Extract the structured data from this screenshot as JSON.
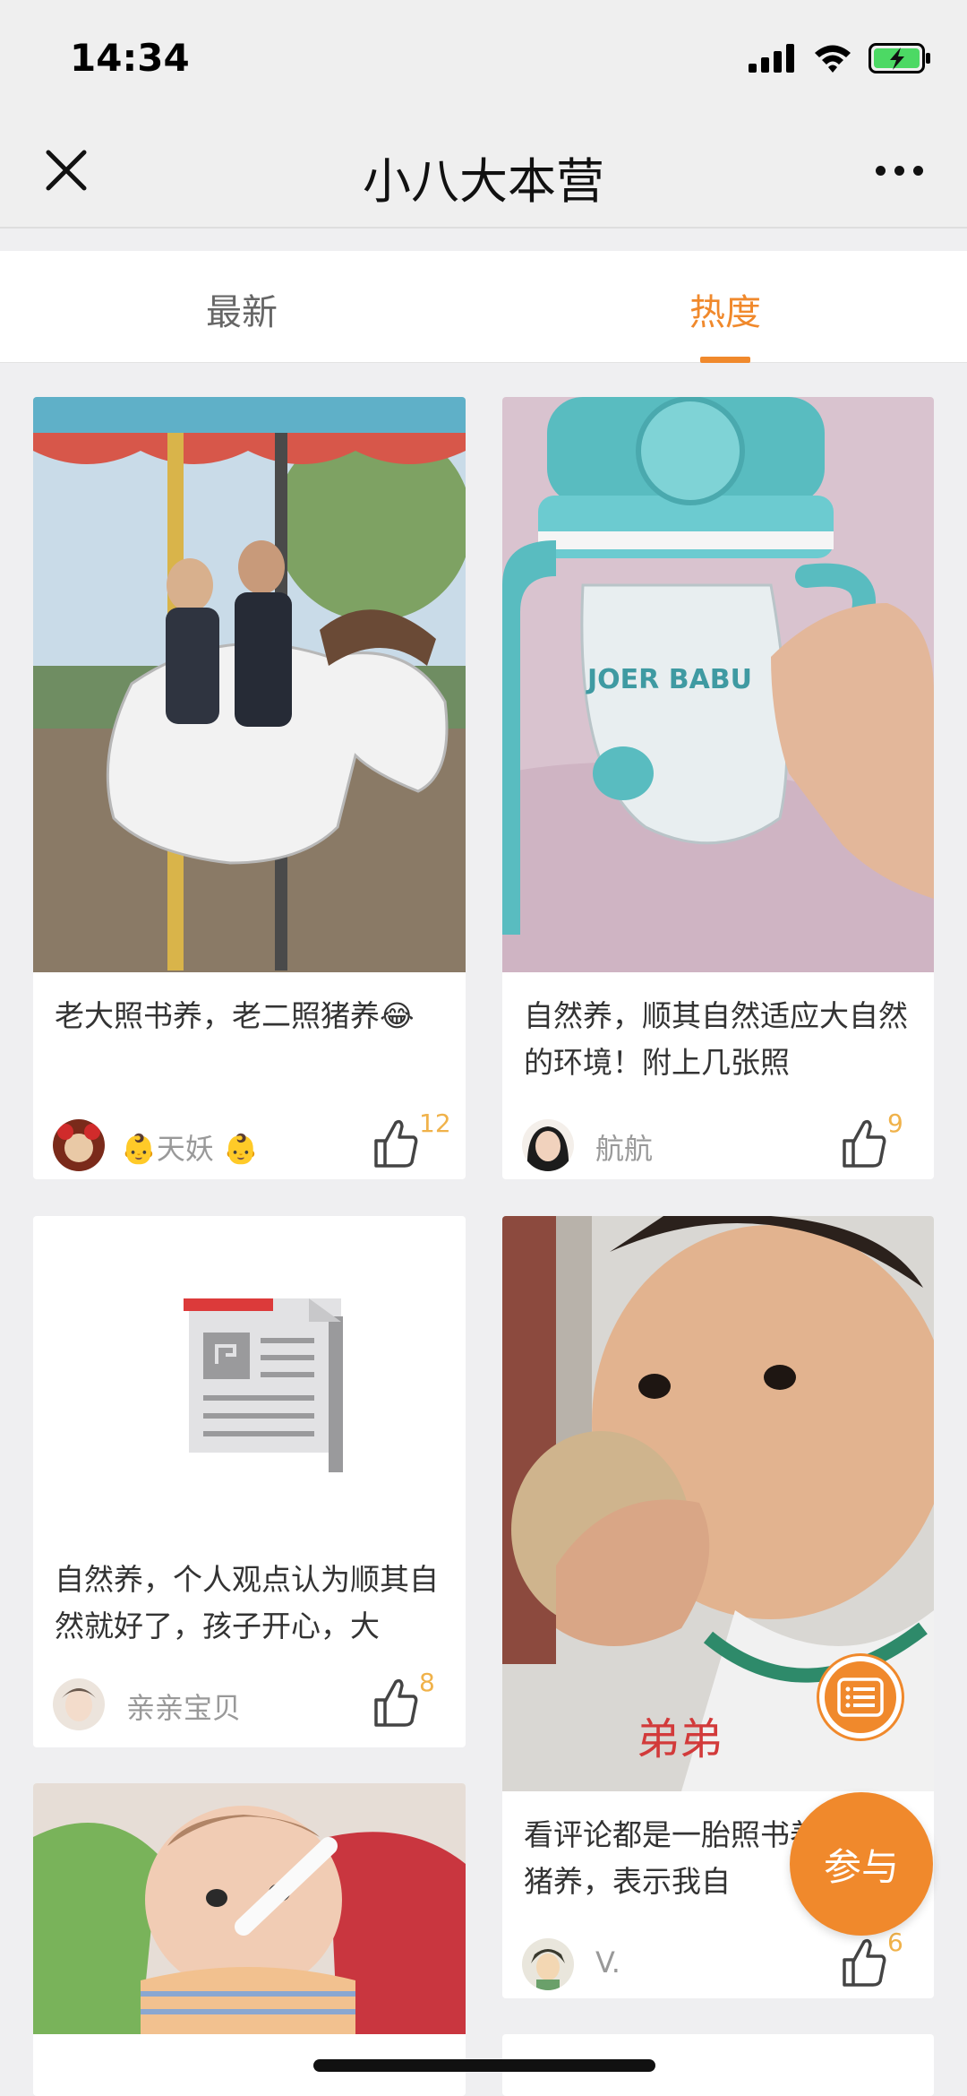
{
  "status_bar": {
    "time": "14:34"
  },
  "nav": {
    "title": "小八大本营"
  },
  "tabs": [
    {
      "label": "最新"
    },
    {
      "label": "热度"
    }
  ],
  "cards": [
    {
      "text": "老大照书养，老二照猪养😂",
      "author": "👶天妖 👶",
      "likes": "12"
    },
    {
      "text": "自然养，顺其自然适应大自然的环境！附上几张照",
      "author": "航航",
      "likes": "9"
    },
    {
      "text": "自然养，个人观点认为顺其自然就好了，孩子开心，大",
      "author": "亲亲宝贝",
      "likes": "8"
    },
    {
      "text": "看评论都是一胎照书养二胎照猪养，表示我自",
      "author": "V.",
      "likes": "6"
    }
  ],
  "bottle_brand": "JOER BABU",
  "fab": {
    "join_label": "参与"
  },
  "colors": {
    "accent": "#f0892c",
    "like_count": "#f0b24a"
  }
}
